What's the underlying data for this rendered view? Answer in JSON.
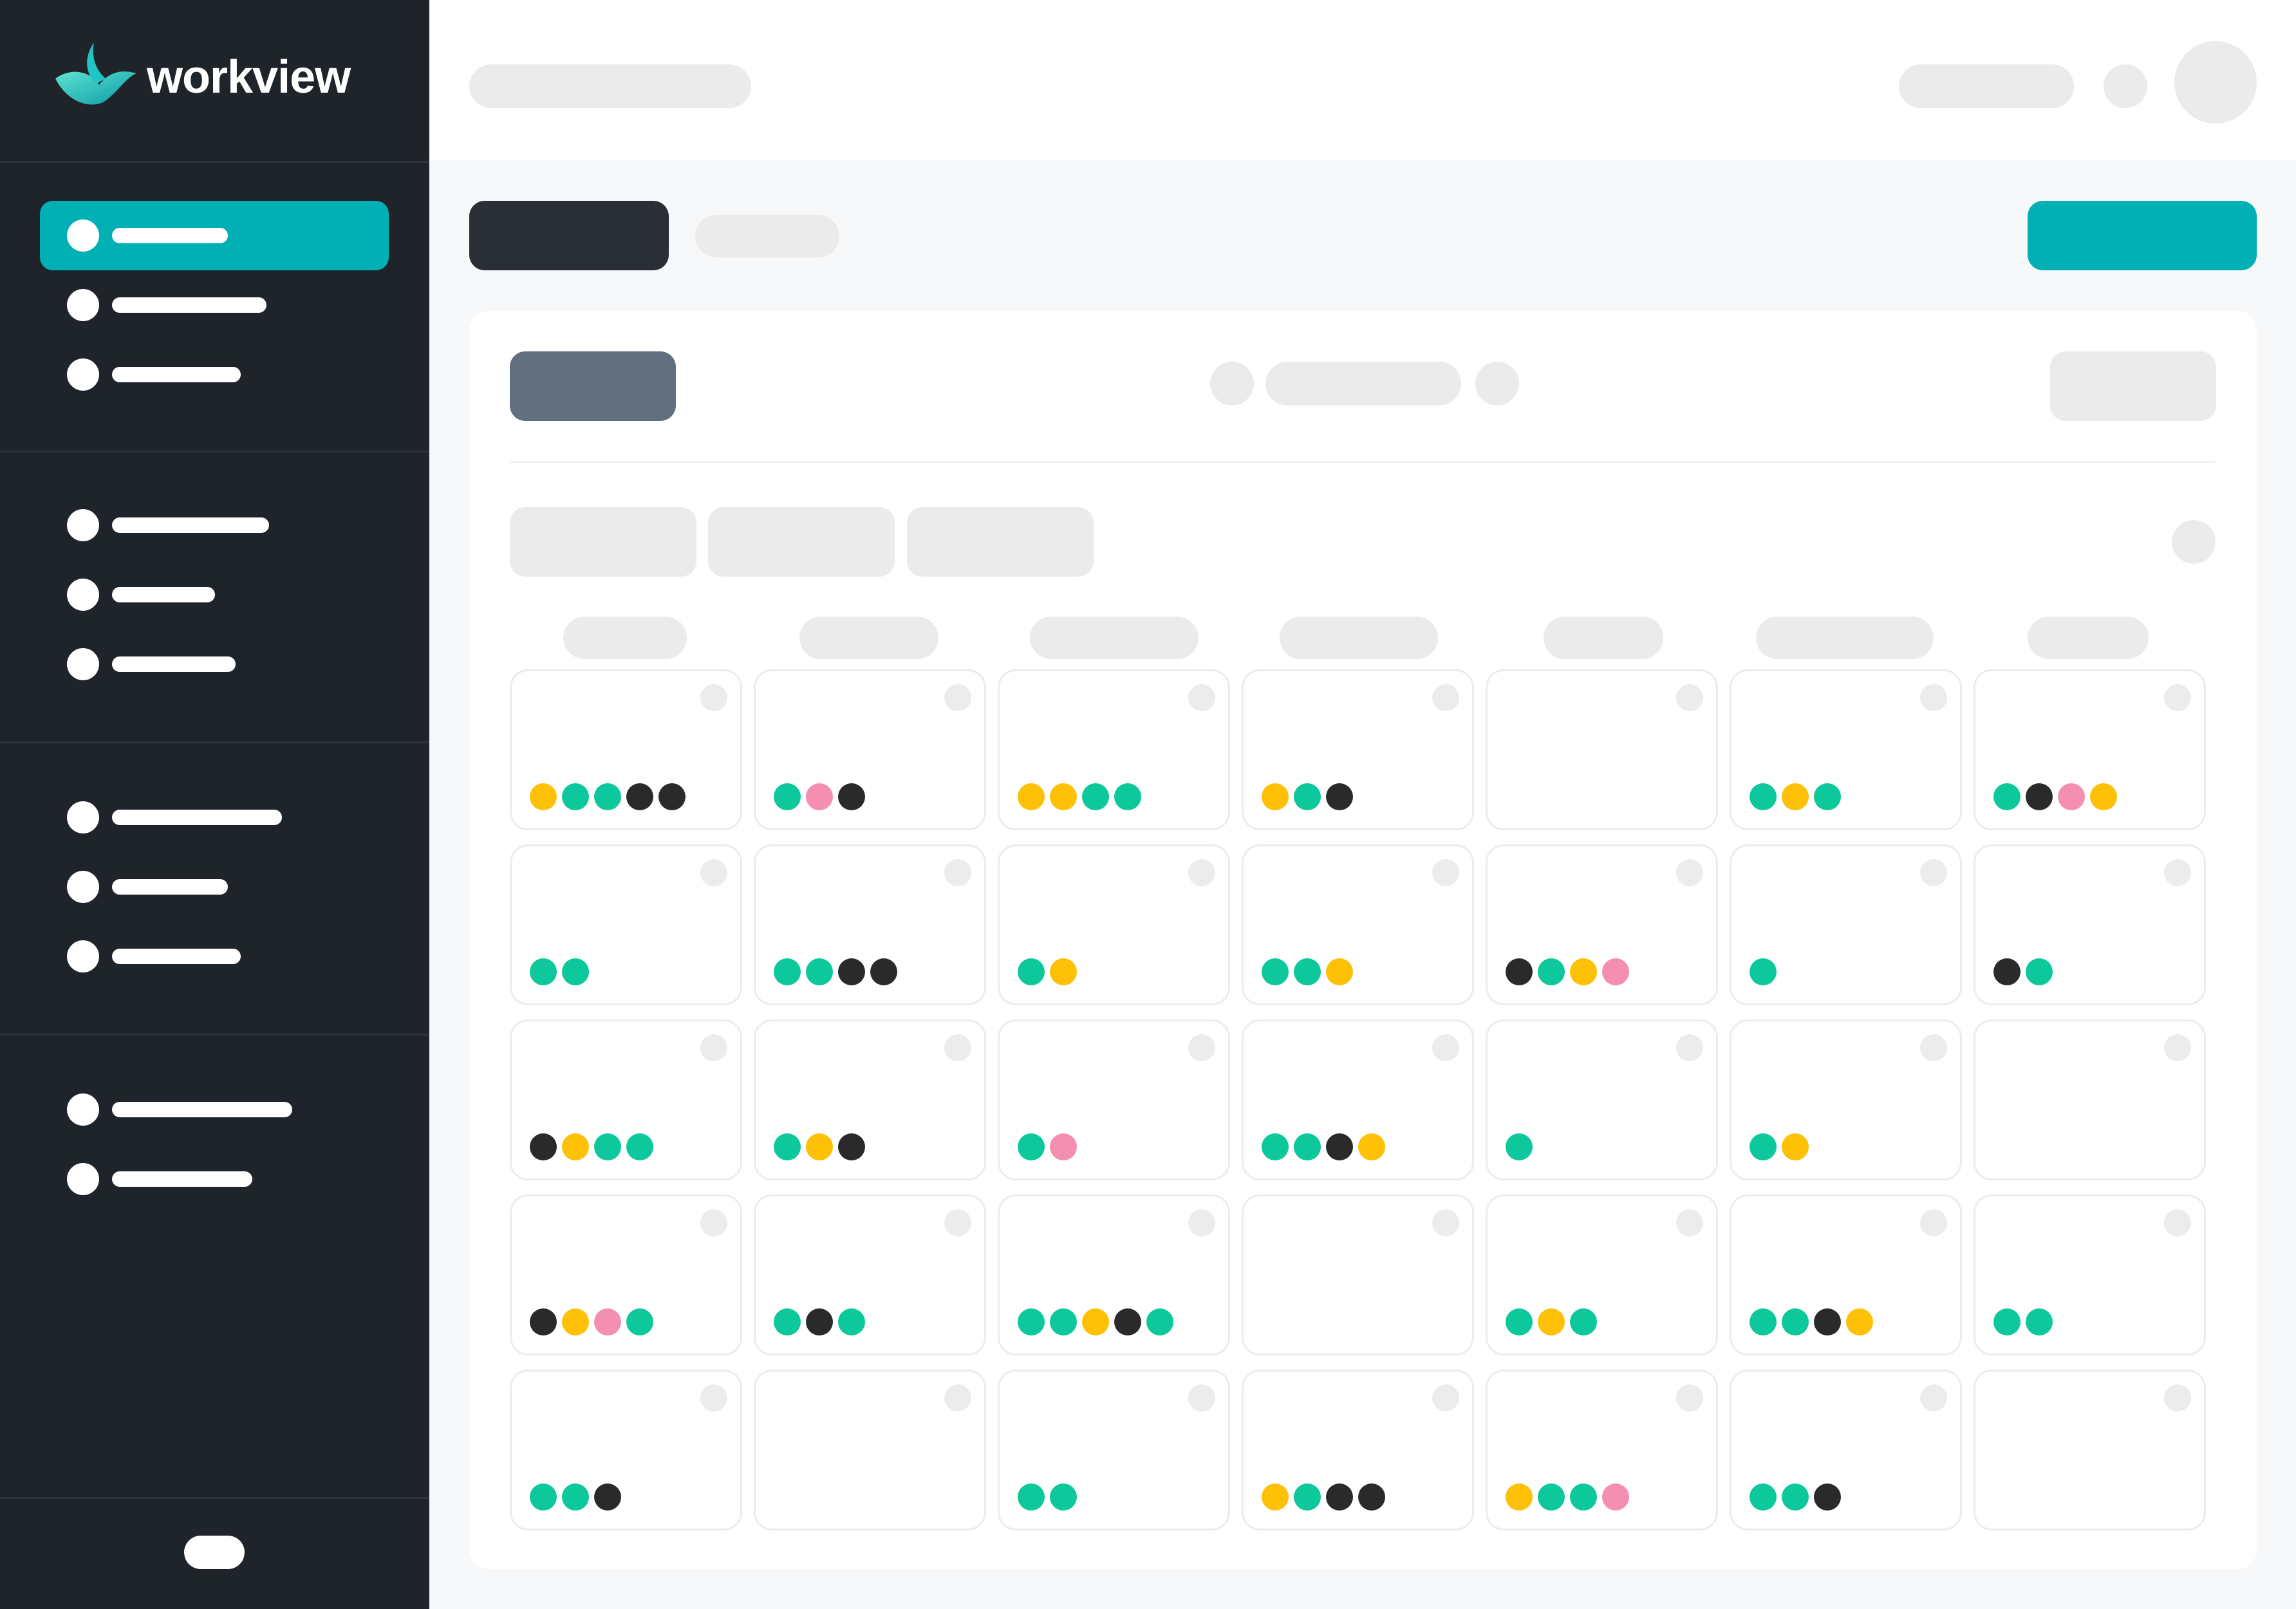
{
  "app": {
    "name": "workview"
  },
  "colors": {
    "sidebar": "#1f232a",
    "accent": "#00b0b5",
    "dark_button": "#2a2e35",
    "slate_button": "#626f7e",
    "placeholder": "#ebebeb",
    "event_green": "#0cc89a",
    "event_yellow": "#ffc107",
    "event_black": "#2a2a2a",
    "event_pink": "#f48fb1"
  },
  "icons": {
    "logo": "bird-logo-icon",
    "nav_item": "circle-icon"
  },
  "calendar": {
    "weeks": [
      [
        [
          "yellow",
          "green",
          "green",
          "black",
          "black"
        ],
        [
          "green",
          "pink",
          "black"
        ],
        [
          "yellow",
          "yellow",
          "green",
          "green"
        ],
        [
          "yellow",
          "green",
          "black"
        ],
        [],
        [
          "green",
          "yellow",
          "green"
        ],
        [
          "green",
          "black",
          "pink",
          "yellow"
        ]
      ],
      [
        [
          "green",
          "green"
        ],
        [
          "green",
          "green",
          "black",
          "black"
        ],
        [
          "green",
          "yellow"
        ],
        [
          "green",
          "green",
          "yellow"
        ],
        [
          "black",
          "green",
          "yellow",
          "pink"
        ],
        [
          "green"
        ],
        [
          "black",
          "green"
        ]
      ],
      [
        [
          "black",
          "yellow",
          "green",
          "green"
        ],
        [
          "green",
          "yellow",
          "black"
        ],
        [
          "green",
          "pink"
        ],
        [
          "green",
          "green",
          "black",
          "yellow"
        ],
        [
          "green"
        ],
        [
          "green",
          "yellow"
        ],
        []
      ],
      [
        [
          "black",
          "yellow",
          "pink",
          "green"
        ],
        [
          "green",
          "black",
          "green"
        ],
        [
          "green",
          "green",
          "yellow",
          "black",
          "green"
        ],
        [],
        [
          "green",
          "yellow",
          "green"
        ],
        [
          "green",
          "green",
          "black",
          "yellow"
        ],
        [
          "green",
          "green"
        ]
      ],
      [
        [
          "green",
          "green",
          "black"
        ],
        [],
        [
          "green",
          "green"
        ],
        [
          "yellow",
          "green",
          "black",
          "black"
        ],
        [
          "yellow",
          "green",
          "green",
          "pink"
        ],
        [
          "green",
          "green",
          "black"
        ],
        []
      ]
    ]
  }
}
